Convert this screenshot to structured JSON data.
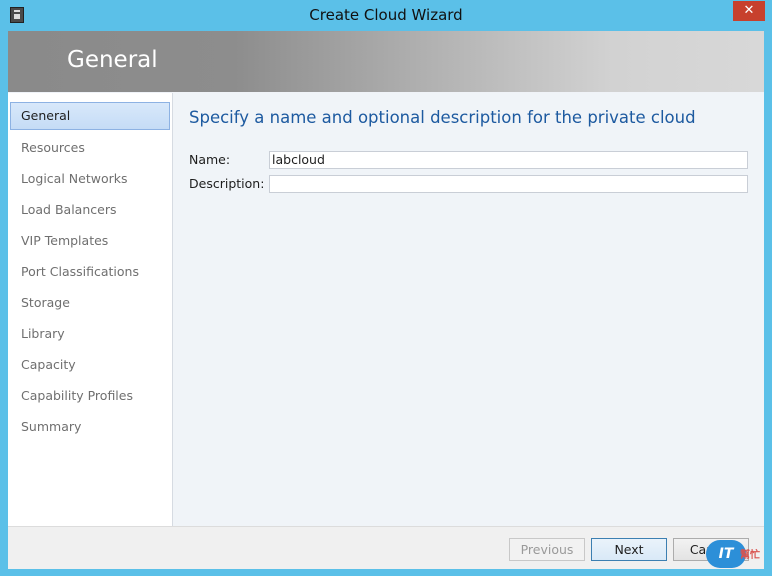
{
  "window": {
    "title": "Create Cloud Wizard",
    "close_glyph": "✕"
  },
  "header": {
    "title": "General"
  },
  "sidebar": {
    "items": [
      {
        "label": "General",
        "active": true
      },
      {
        "label": "Resources"
      },
      {
        "label": "Logical Networks"
      },
      {
        "label": "Load Balancers"
      },
      {
        "label": "VIP Templates"
      },
      {
        "label": "Port Classifications"
      },
      {
        "label": "Storage"
      },
      {
        "label": "Library"
      },
      {
        "label": "Capacity"
      },
      {
        "label": "Capability Profiles"
      },
      {
        "label": "Summary"
      }
    ]
  },
  "content": {
    "heading": "Specify a name and optional description for the private cloud",
    "name_label": "Name:",
    "name_value": "labcloud",
    "description_label": "Description:",
    "description_value": ""
  },
  "footer": {
    "previous_label": "Previous",
    "next_label": "Next",
    "cancel_label": "Cancel"
  },
  "watermark": {
    "logo_text": "IT",
    "side_text": "幫忙"
  },
  "colors": {
    "frame": "#5bc0e8",
    "close_button": "#c7402d",
    "heading_blue": "#1d5aa0",
    "selection": "#c5dcf6"
  }
}
